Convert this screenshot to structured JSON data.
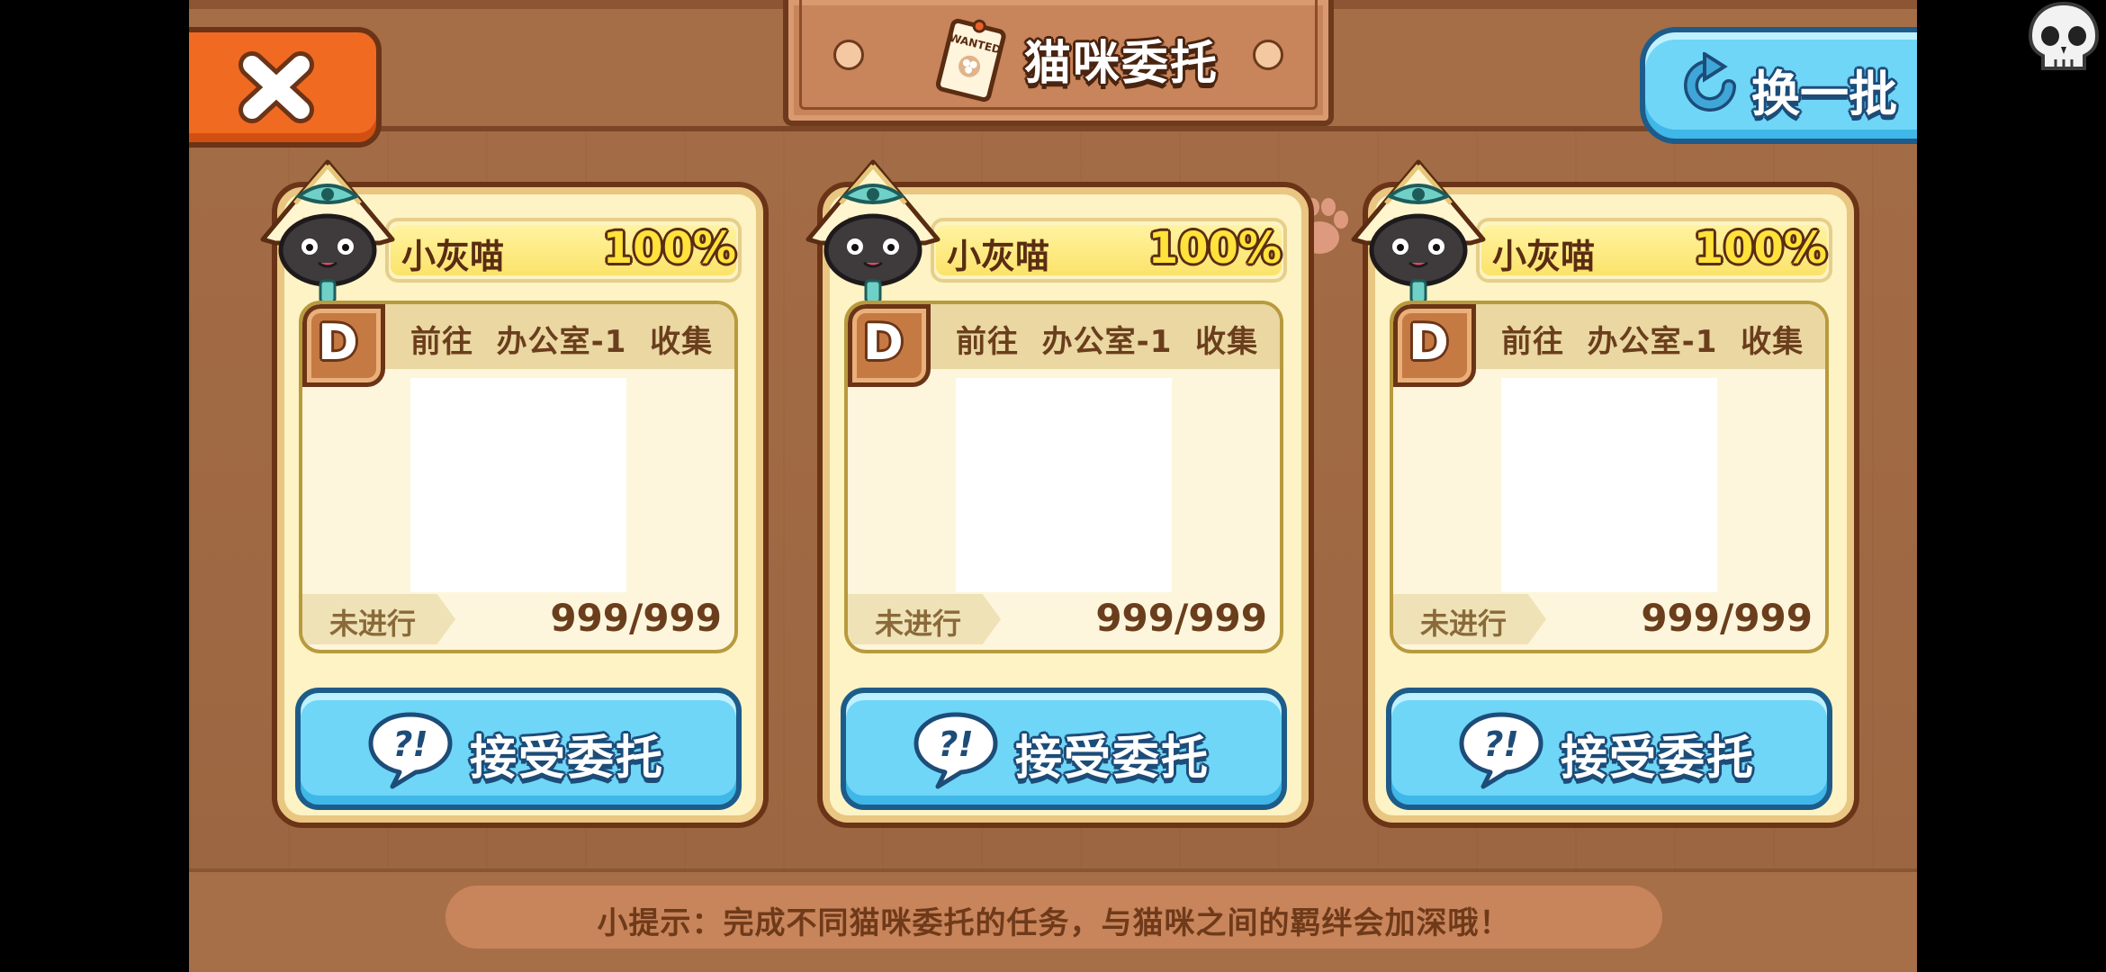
{
  "header": {
    "title": "猫咪委托",
    "refresh_label": "换一批",
    "title_icon_text": "WANTED"
  },
  "cards": [
    {
      "cat_name": "小灰喵",
      "bond_percent": "100%",
      "bond_fill": 1.0,
      "rank": "D",
      "task_text": "前往  办公室-1  收集",
      "status": "未进行",
      "progress": "999/999",
      "accept_label": "接受委托"
    },
    {
      "cat_name": "小灰喵",
      "bond_percent": "100%",
      "bond_fill": 1.0,
      "rank": "D",
      "task_text": "前往  办公室-1  收集",
      "status": "未进行",
      "progress": "999/999",
      "accept_label": "接受委托"
    },
    {
      "cat_name": "小灰喵",
      "bond_percent": "100%",
      "bond_fill": 1.0,
      "rank": "D",
      "task_text": "前往  办公室-1  收集",
      "status": "未进行",
      "progress": "999/999",
      "accept_label": "接受委托"
    }
  ],
  "tip": "小提示：完成不同猫咪委托的任务，与猫咪之间的羁绊会加深哦！",
  "colors": {
    "accent_blue": "#6fd6f7",
    "close_orange": "#f06a22",
    "card_bg": "#fdf3c4",
    "outline_brown": "#6b3417"
  },
  "icons": [
    "close-icon",
    "wanted-poster-icon",
    "refresh-icon",
    "cat-pharaoh-avatar",
    "rank-badge",
    "question-bubble-icon",
    "paw-icon",
    "skull-icon"
  ]
}
